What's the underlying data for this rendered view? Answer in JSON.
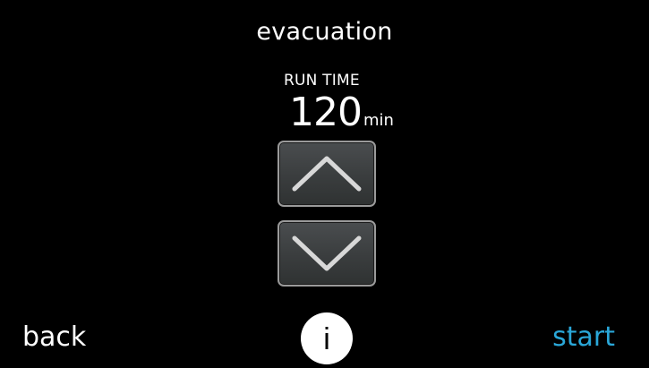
{
  "screen": {
    "title": "evacuation"
  },
  "setting": {
    "label": "RUN TIME",
    "value": "120",
    "unit": "min"
  },
  "controls": {
    "up_icon": "chevron-up-icon",
    "down_icon": "chevron-down-icon"
  },
  "footer": {
    "back_label": "back",
    "info_label": "i",
    "start_label": "start"
  },
  "colors": {
    "background": "#000000",
    "text": "#ffffff",
    "accent": "#2aa7d8",
    "button_face": "#3c3f40",
    "button_border": "#9a9a9a"
  }
}
